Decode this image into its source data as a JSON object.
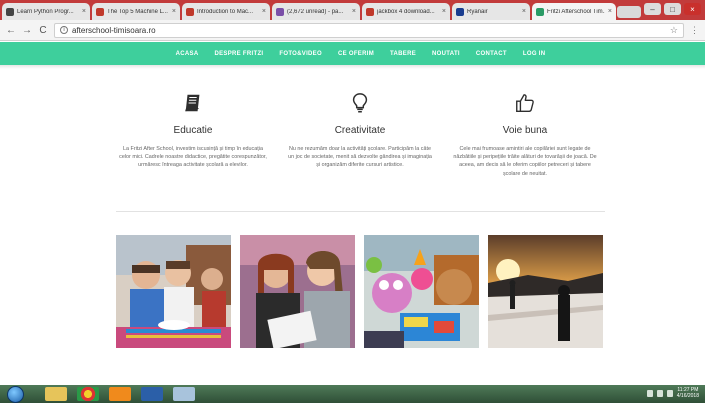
{
  "browser": {
    "tabs": [
      {
        "title": "Learn Python Progr...",
        "favicon_color": "#444444"
      },
      {
        "title": "The Top 5 Machine L...",
        "favicon_color": "#c0392b"
      },
      {
        "title": "Introduction to Mac...",
        "favicon_color": "#c0392b"
      },
      {
        "title": "(2,672 unread) - pa...",
        "favicon_color": "#7b4fa8"
      },
      {
        "title": "jackbox 4 download...",
        "favicon_color": "#c0392b"
      },
      {
        "title": "Ryanair",
        "favicon_color": "#1a3d8f"
      },
      {
        "title": "Fritzi Afterschool Tim...",
        "favicon_color": "#2b9b66"
      }
    ],
    "active_tab_index": 6,
    "close_glyph": "×",
    "url": "afterschool-timisoara.ro",
    "nav_back": "←",
    "nav_forward": "→",
    "nav_reload": "C",
    "star_glyph": "☆",
    "info_glyph": "i",
    "window_controls": [
      "–",
      "□",
      "×"
    ]
  },
  "site_nav": {
    "items": [
      "ACASA",
      "DESPRE FRITZI",
      "FOTO&VIDEO",
      "CE OFERIM",
      "TABERE",
      "NOUTATI",
      "CONTACT",
      "LOG IN"
    ],
    "background": "#3ecf9c"
  },
  "features": [
    {
      "icon": "book-icon",
      "title": "Educatie",
      "text": "La Fritzi After School, investim iscusință și timp în educația celor mici. Cadrele noastre didactice, pregătite corespunzător, urmăresc întreaga activitate școlară a elevilor."
    },
    {
      "icon": "lightbulb-icon",
      "title": "Creativitate",
      "text": "Nu ne rezumăm doar la activități școlare. Participăm la câte un joc de societate, menit să dezvolte gândirea și imaginația și organizăm diferite cursuri artistice."
    },
    {
      "icon": "thumbs-up-icon",
      "title": "Voie buna",
      "text": "Cele mai frumoase amintiri ale copilăriei sunt legate de năzbâtiile și peripețiile trăite alături de tovarășii de joacă. De aceea, am decis să le oferim copiilor petreceri și tabere școlare de neuitat."
    }
  ],
  "photos": [
    {
      "subject": "children-eating-photo"
    },
    {
      "subject": "girls-reading-photo"
    },
    {
      "subject": "toys-photo"
    },
    {
      "subject": "ski-slope-photo"
    }
  ],
  "taskbar": {
    "apps": [
      "explorer-icon",
      "chrome-icon",
      "vlc-icon",
      "word-icon",
      "folder-icon"
    ],
    "clock_time": "11:27 PM",
    "clock_date": "4/16/2018"
  }
}
